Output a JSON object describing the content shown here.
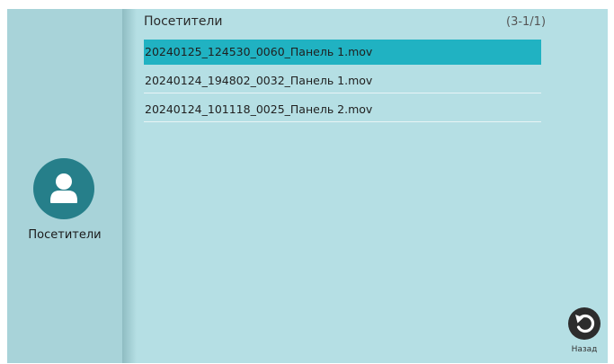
{
  "sidebar": {
    "icon": "user-avatar-icon",
    "label": "Посетители"
  },
  "list": {
    "title": "Посетители",
    "counter": "(3-1/1)",
    "files": [
      "20240125_124530_0060_Панель 1.mov",
      "20240124_194802_0032_Панель 1.mov",
      "20240124_101118_0025_Панель 2.mov"
    ],
    "selected_index": 0
  },
  "back": {
    "label": "Назад",
    "icon": "undo-arrow-icon"
  },
  "colors": {
    "background": "#b5dfe4",
    "sidebar": "#a8d3d9",
    "avatar": "#267f8a",
    "selected_row": "#20b2c2",
    "back_button": "#2d2d2d"
  }
}
